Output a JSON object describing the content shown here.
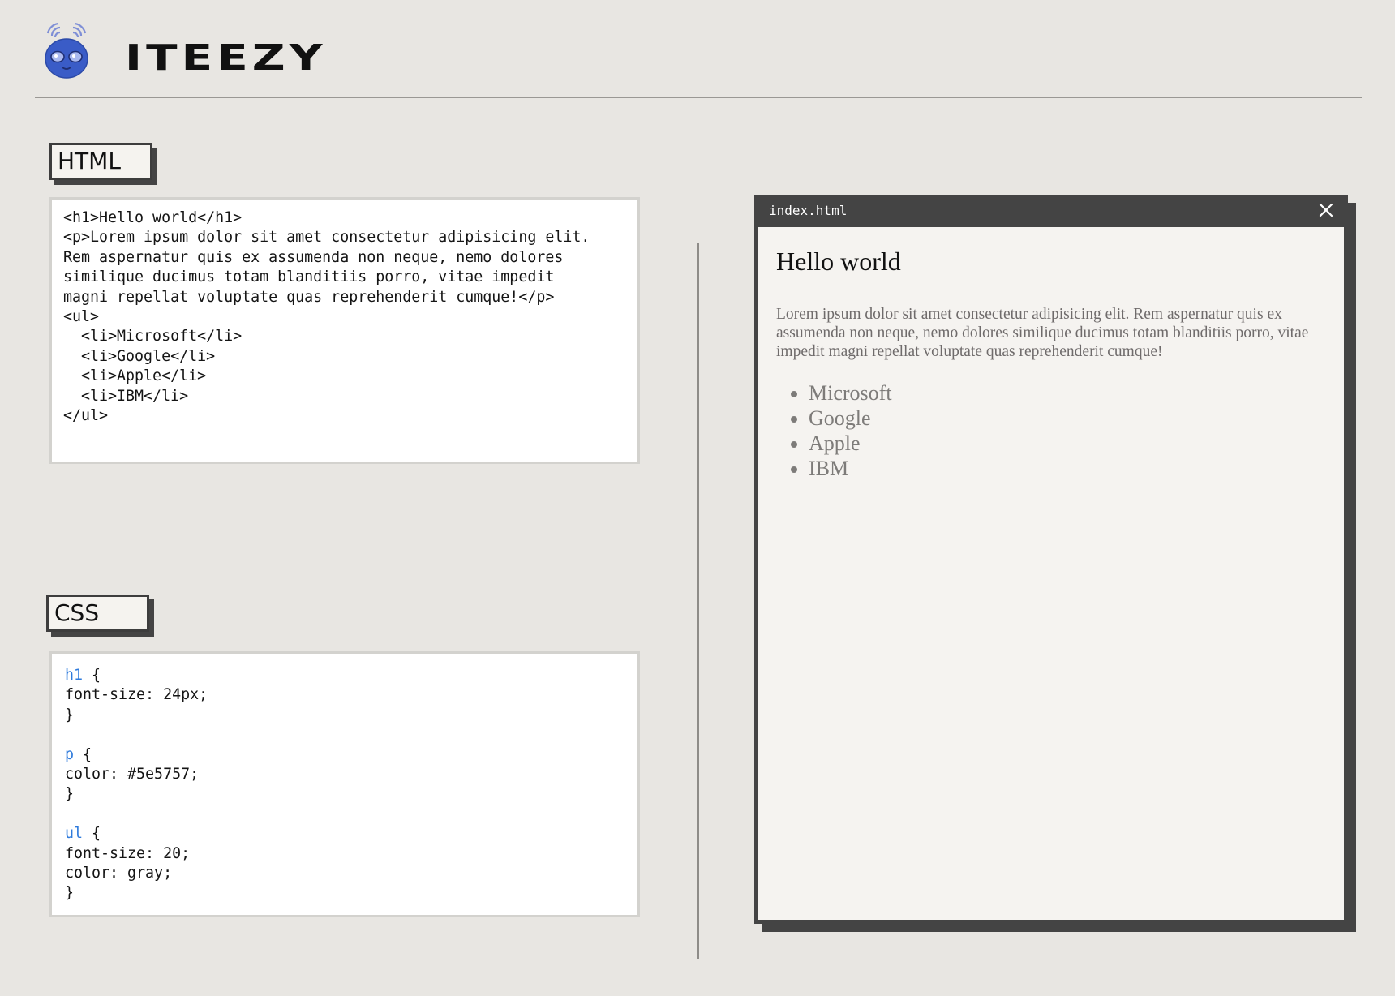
{
  "brand": {
    "name": "ITEEZY",
    "logo_icon": "robot-mascot-icon",
    "logo_color": "#3a5cc7"
  },
  "html_section": {
    "label": "HTML",
    "code_lines": [
      "<h1>Hello world</h1>",
      "<p>Lorem ipsum dolor sit amet consectetur adipisicing elit.",
      "Rem aspernatur quis ex assumenda non neque, nemo dolores",
      "similique ducimus totam blanditiis porro, vitae impedit",
      "magni repellat voluptate quas reprehenderit cumque!</p>",
      "<ul>",
      "  <li>Microsoft</li>",
      "  <li>Google</li>",
      "  <li>Apple</li>",
      "  <li>IBM</li>",
      "</ul>"
    ]
  },
  "css_section": {
    "label": "CSS",
    "selector_color": "#2f7bdc",
    "rules": [
      {
        "selector": "h1",
        "open": " {",
        "declarations": [
          "font-size: 24px;"
        ],
        "close": "}"
      },
      {
        "selector": "p",
        "open": " {",
        "declarations": [
          "color: #5e5757;"
        ],
        "close": "}"
      },
      {
        "selector": "ul",
        "open": " {",
        "declarations": [
          "font-size: 20;",
          "color: gray;"
        ],
        "close": "}"
      }
    ]
  },
  "preview_window": {
    "title": "index.html",
    "close_icon": "close-icon",
    "heading": "Hello world",
    "paragraph": "Lorem ipsum dolor sit amet consectetur adipisicing elit. Rem aspernatur quis ex assumenda non neque, nemo dolores similique ducimus totam blanditiis porro, vitae impedit magni repellat voluptate quas reprehenderit cumque!",
    "list_items": [
      "Microsoft",
      "Google",
      "Apple",
      "IBM"
    ]
  }
}
